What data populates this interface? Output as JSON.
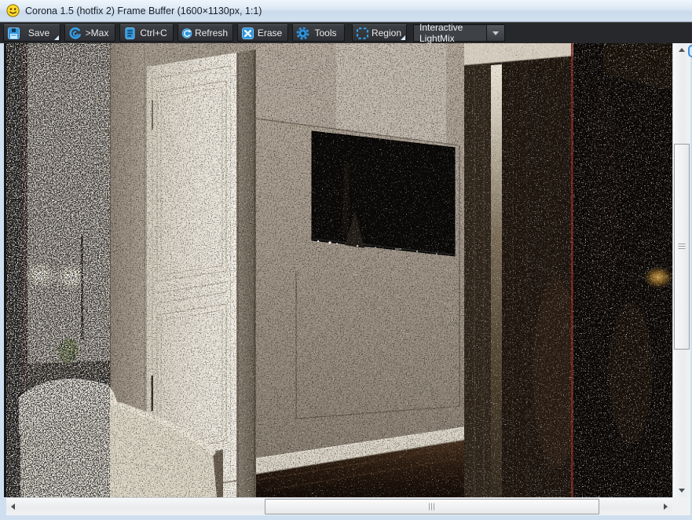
{
  "window": {
    "title": "Corona 1.5 (hotfix 2) Frame Buffer (1600×1130px, 1:1)",
    "app_icon": "smiley-face-icon"
  },
  "toolbar": {
    "buttons": [
      {
        "label": "Save",
        "icon": "floppy-save-icon",
        "has_dropdown": true
      },
      {
        "label": ">Max",
        "icon": "corona-swirl-icon",
        "has_dropdown": false
      },
      {
        "label": "Ctrl+C",
        "icon": "copy-document-icon",
        "has_dropdown": false
      },
      {
        "label": "Refresh",
        "icon": "refresh-circular-arrow-icon",
        "has_dropdown": false
      },
      {
        "label": "Erase",
        "icon": "erase-x-icon",
        "has_dropdown": false
      },
      {
        "label": "Tools",
        "icon": "gear-icon",
        "has_dropdown": false
      },
      {
        "label": "Region",
        "icon": "region-marquee-icon",
        "has_dropdown": true
      }
    ],
    "render_mode_dropdown": {
      "value": "Interactive LightMix",
      "icon": "chevron-down-icon"
    }
  },
  "viewport": {
    "content": "noisy in-progress interior render",
    "visible_elements": [
      "wall-sconce-glows",
      "bed-with-pillow",
      "white-paneled-door",
      "wall-mounted-tv",
      "tv-wall-panel",
      "white-baseboard",
      "dark-wood-floor",
      "dark-doorway-with-mirror-strip",
      "render-region-red-lines"
    ],
    "colors": {
      "region_line_red": "#77241d",
      "tv_black": "#0c0a08",
      "wall_gray": "#a3988a",
      "door_white": "#e7e2d6",
      "floor_brown": "#2a1b10",
      "sconce_glow": "#fdf6dd"
    }
  },
  "chrome_colors": {
    "titlebar_top": "#eef5fb",
    "titlebar_bottom": "#d2e0ee",
    "title_text": "#1a1f24",
    "toolbar_bg": "#26282b",
    "button_face": "#34373c",
    "button_text": "#e9e9e9",
    "icon_blue": "#35a0e6",
    "scrollbar_track": "#eef0f1"
  }
}
